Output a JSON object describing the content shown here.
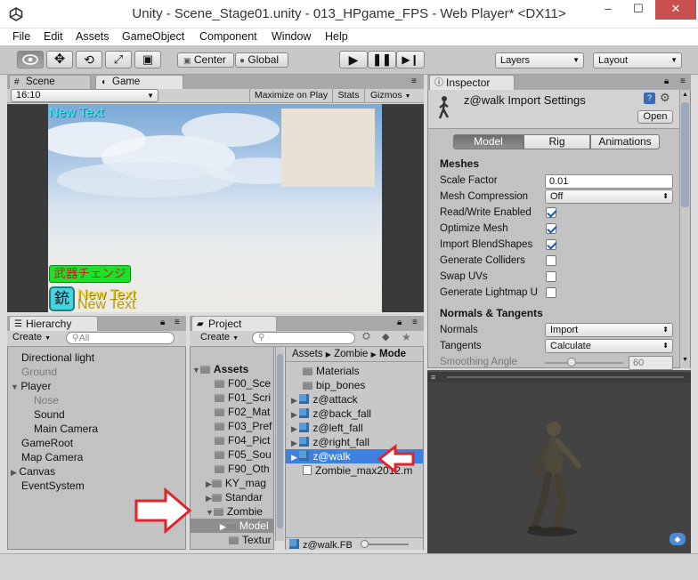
{
  "window": {
    "title": "Unity - Scene_Stage01.unity - 013_HPgame_FPS - Web Player* <DX11>",
    "minimize": "–",
    "maximize": "☐",
    "close": "✕"
  },
  "menu": [
    "File",
    "Edit",
    "Assets",
    "GameObject",
    "Component",
    "Window",
    "Help"
  ],
  "toolbar": {
    "center_label": "Center",
    "global_label": "Global",
    "layers_label": "Layers",
    "layout_label": "Layout"
  },
  "scene_tab": "Scene",
  "game_tab": "Game",
  "game": {
    "aspect": "16:10",
    "maximize_label": "Maximize on Play",
    "stats_label": "Stats",
    "gizmos_label": "Gizmos",
    "new_text_top": "New Text",
    "weapon_change": "武器チェンジ",
    "gun_kanji": "銃",
    "new_text_bottom": "New Text",
    "new_text_shadow": "New Text"
  },
  "hierarchy": {
    "tab": "Hierarchy",
    "create": "Create",
    "search_placeholder": "All",
    "items": [
      {
        "label": "Directional light"
      },
      {
        "label": "Ground"
      },
      {
        "label": "Player"
      },
      {
        "label": "Nose"
      },
      {
        "label": "Sound"
      },
      {
        "label": "Main Camera"
      },
      {
        "label": "GameRoot"
      },
      {
        "label": "Map Camera"
      },
      {
        "label": "Canvas"
      },
      {
        "label": "EventSystem"
      }
    ]
  },
  "project": {
    "tab": "Project",
    "create": "Create",
    "folders": [
      {
        "label": "Assets"
      },
      {
        "label": "F00_Sce"
      },
      {
        "label": "F01_Scri"
      },
      {
        "label": "F02_Mat"
      },
      {
        "label": "F03_Pref"
      },
      {
        "label": "F04_Pict"
      },
      {
        "label": "F05_Sou"
      },
      {
        "label": "F90_Oth"
      },
      {
        "label": "KY_mag"
      },
      {
        "label": "Standar"
      },
      {
        "label": "Zombie"
      },
      {
        "label": "Model"
      },
      {
        "label": "Textur"
      }
    ],
    "breadcrumb": [
      "Assets",
      "Zombie",
      "Mode"
    ],
    "files": [
      {
        "label": "Materials"
      },
      {
        "label": "bip_bones"
      },
      {
        "label": "z@attack"
      },
      {
        "label": "z@back_fall"
      },
      {
        "label": "z@left_fall"
      },
      {
        "label": "z@right_fall"
      },
      {
        "label": "z@walk"
      },
      {
        "label": "Zombie_max2012.m"
      }
    ],
    "footer_file": "z@walk.FB"
  },
  "inspector": {
    "tab": "Inspector",
    "title": "z@walk Import Settings",
    "open_label": "Open",
    "tabs": [
      "Model",
      "Rig",
      "Animations"
    ],
    "meshes_header": "Meshes",
    "scale_factor_label": "Scale Factor",
    "scale_factor_value": "0.01",
    "mesh_compression_label": "Mesh Compression",
    "mesh_compression_value": "Off",
    "read_write_label": "Read/Write Enabled",
    "optimize_mesh_label": "Optimize Mesh",
    "import_blendshapes_label": "Import BlendShapes",
    "generate_colliders_label": "Generate Colliders",
    "swap_uvs_label": "Swap UVs",
    "generate_lightmap_label": "Generate Lightmap U",
    "normals_tangents_header": "Normals & Tangents",
    "normals_label": "Normals",
    "normals_value": "Import",
    "tangents_label": "Tangents",
    "tangents_value": "Calculate",
    "smoothing_angle_label": "Smoothing Angle",
    "smoothing_angle_value": "60"
  },
  "colors": {
    "selection": "#3d80df",
    "annotation_arrow": "#e0242b",
    "new_text_cyan": "#3ff0ff",
    "weapon_bg": "#1ee02a",
    "gold_text": "#f2d21a"
  }
}
